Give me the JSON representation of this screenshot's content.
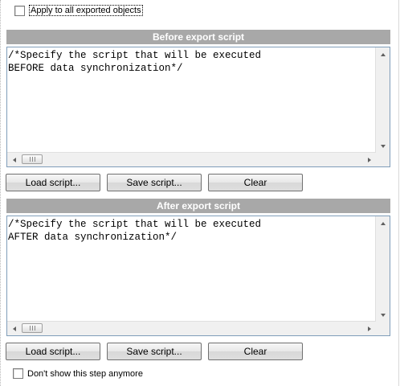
{
  "apply_all": {
    "label": "Apply to all exported objects",
    "checked": false
  },
  "before": {
    "header": "Before export script",
    "script_lines": [
      "/*Specify the script that will be executed",
      "BEFORE data synchronization*/"
    ],
    "buttons": {
      "load": "Load script...",
      "save": "Save script...",
      "clear": "Clear"
    }
  },
  "after": {
    "header": "After export script",
    "script_lines": [
      "/*Specify the script that will be executed",
      "AFTER data synchronization*/"
    ],
    "buttons": {
      "load": "Load script...",
      "save": "Save script...",
      "clear": "Clear"
    }
  },
  "dont_show": {
    "label": "Don't show this step anymore",
    "checked": false
  },
  "colors": {
    "header_bg": "#a8a8a8",
    "editor_border": "#7f9db9"
  },
  "icons": [
    "scroll-up-icon",
    "scroll-down-icon",
    "scroll-left-icon",
    "scroll-right-icon",
    "scroll-grip-icon"
  ]
}
